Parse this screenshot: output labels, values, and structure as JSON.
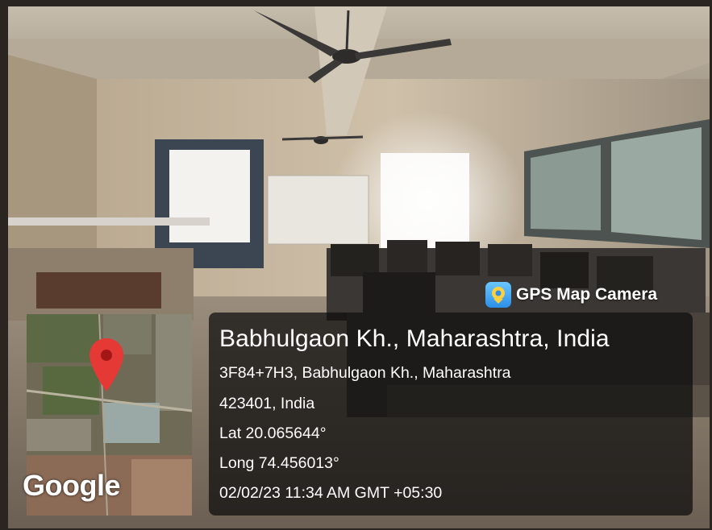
{
  "badge": {
    "app_name": "GPS Map Camera",
    "icon": "gps-map-camera-icon"
  },
  "map": {
    "provider_logo": "Google",
    "pin": "location-pin-icon"
  },
  "location": {
    "place": "Babhulgaon Kh., Maharashtra, India",
    "address_line1": "3F84+7H3, Babhulgaon Kh., Maharashtra",
    "address_line2": "423401, India",
    "latitude": "Lat 20.065644°",
    "longitude": "Long 74.456013°",
    "timestamp": "02/02/23 11:34 AM GMT +05:30"
  },
  "colors": {
    "pin": "#e53935",
    "panel": "#111111",
    "text": "#ffffff"
  }
}
